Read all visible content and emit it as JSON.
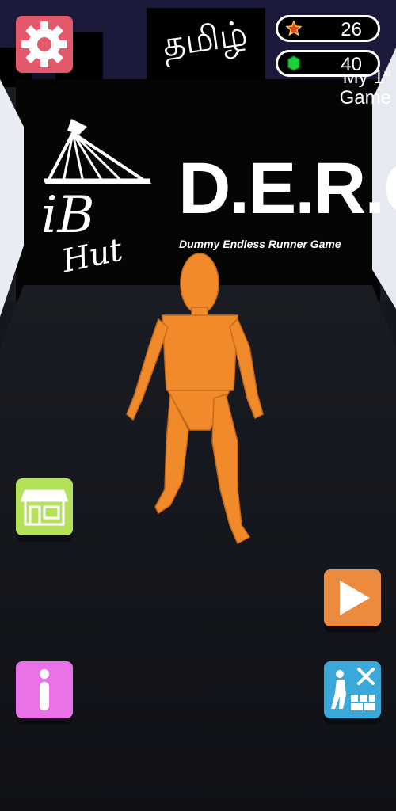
{
  "hud": {
    "stars": "26",
    "gems": "40"
  },
  "sign": {
    "tamil": "தமிழ்",
    "derg": "D.E.R.G",
    "derg_subtitle": "Dummy Endless Runner Game",
    "first_game_line1": "My 1",
    "first_game_sup": "st",
    "first_game_line2": "Game",
    "logo_text_1": "iB",
    "logo_text_2": "Hut"
  },
  "colors": {
    "settings": "#e3586b",
    "shop": "#b5e05a",
    "play": "#ec8a3d",
    "info": "#ea72e8",
    "build": "#3aa8d8",
    "dummy": "#f08a2a"
  },
  "icons": {
    "settings": "gear-icon",
    "shop": "shop-icon",
    "play": "play-icon",
    "info": "info-icon",
    "build": "builder-icon",
    "star": "star-icon",
    "gem": "gem-icon"
  }
}
